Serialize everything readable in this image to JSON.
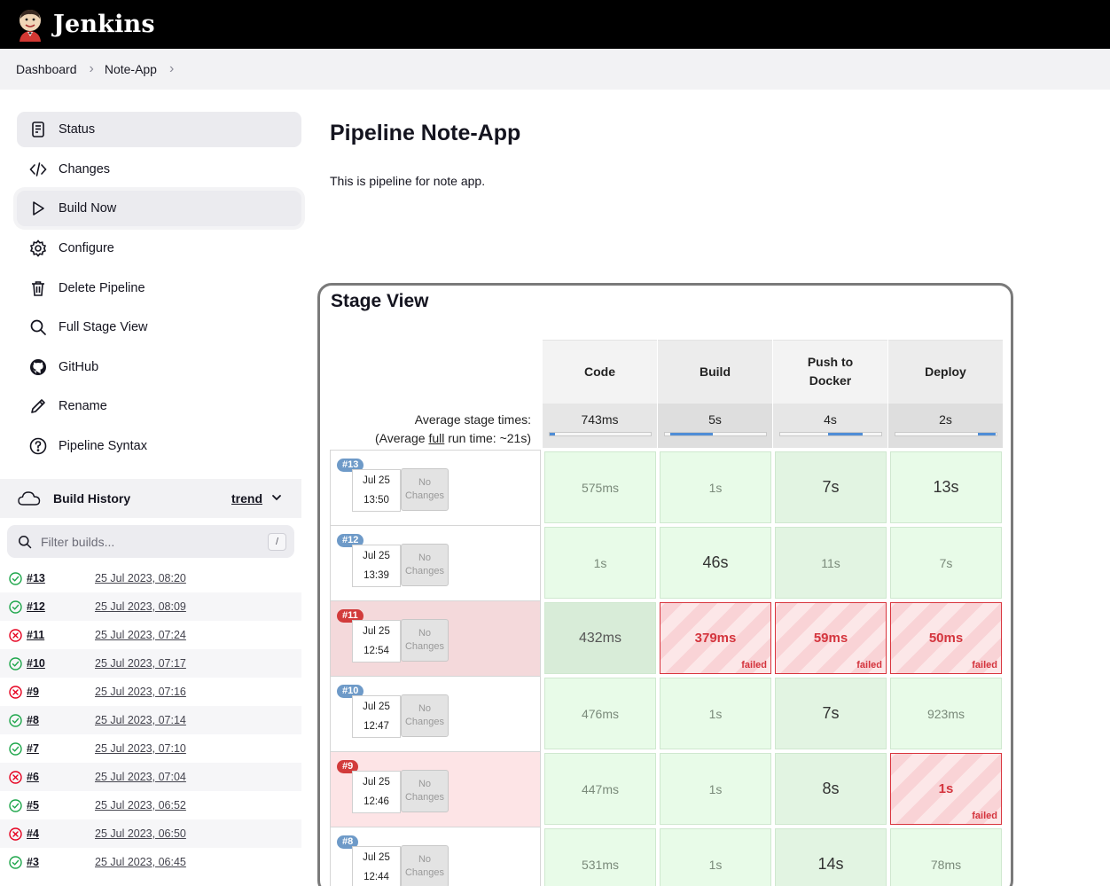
{
  "header": {
    "app_name": "Jenkins"
  },
  "breadcrumb": [
    "Dashboard",
    "Note-App"
  ],
  "sidebar": {
    "tasks": [
      {
        "label": "Status",
        "icon": "status-icon"
      },
      {
        "label": "Changes",
        "icon": "code-icon"
      },
      {
        "label": "Build Now",
        "icon": "play-icon"
      },
      {
        "label": "Configure",
        "icon": "gear-icon"
      },
      {
        "label": "Delete Pipeline",
        "icon": "trash-icon"
      },
      {
        "label": "Full Stage View",
        "icon": "search-icon"
      },
      {
        "label": "GitHub",
        "icon": "github-icon"
      },
      {
        "label": "Rename",
        "icon": "pencil-icon"
      },
      {
        "label": "Pipeline Syntax",
        "icon": "help-icon"
      }
    ]
  },
  "build_history": {
    "title": "Build History",
    "trend_label": "trend",
    "filter_placeholder": "Filter builds...",
    "filter_shortcut": "/",
    "builds": [
      {
        "number": "#13",
        "date": "25 Jul 2023, 08:20",
        "status": "success"
      },
      {
        "number": "#12",
        "date": "25 Jul 2023, 08:09",
        "status": "success"
      },
      {
        "number": "#11",
        "date": "25 Jul 2023, 07:24",
        "status": "failed"
      },
      {
        "number": "#10",
        "date": "25 Jul 2023, 07:17",
        "status": "success"
      },
      {
        "number": "#9",
        "date": "25 Jul 2023, 07:16",
        "status": "failed"
      },
      {
        "number": "#8",
        "date": "25 Jul 2023, 07:14",
        "status": "success"
      },
      {
        "number": "#7",
        "date": "25 Jul 2023, 07:10",
        "status": "success"
      },
      {
        "number": "#6",
        "date": "25 Jul 2023, 07:04",
        "status": "failed"
      },
      {
        "number": "#5",
        "date": "25 Jul 2023, 06:52",
        "status": "success"
      },
      {
        "number": "#4",
        "date": "25 Jul 2023, 06:50",
        "status": "failed"
      },
      {
        "number": "#3",
        "date": "25 Jul 2023, 06:45",
        "status": "success"
      }
    ]
  },
  "main": {
    "title": "Pipeline Note-App",
    "description": "This is pipeline for note app."
  },
  "stage_view": {
    "title": "Stage View",
    "avg_label_line1": "Average stage times:",
    "avg_label_prefix": "(Average ",
    "avg_label_link": "full",
    "avg_label_suffix": " run time: ~21s)",
    "no_changes_line1": "No",
    "no_changes_line2": "Changes",
    "failed_label": "failed",
    "stages": [
      {
        "name": "Code",
        "avg": "743ms",
        "avg_fraction": 0.05
      },
      {
        "name": "Build",
        "avg": "5s",
        "avg_fraction": 0.42
      },
      {
        "name": "Push to Docker",
        "avg": "4s",
        "avg_fraction": 0.35
      },
      {
        "name": "Deploy",
        "avg": "2s",
        "avg_fraction": 0.17
      }
    ],
    "runs": [
      {
        "badge": "#13",
        "date": "Jul 25",
        "time": "13:50",
        "status": "success",
        "cells": [
          {
            "v": "575ms",
            "s": "ok"
          },
          {
            "v": "1s",
            "s": "ok"
          },
          {
            "v": "7s",
            "s": "ok-big"
          },
          {
            "v": "13s",
            "s": "ok-big"
          }
        ]
      },
      {
        "badge": "#12",
        "date": "Jul 25",
        "time": "13:39",
        "status": "success",
        "cells": [
          {
            "v": "1s",
            "s": "ok"
          },
          {
            "v": "46s",
            "s": "ok-big"
          },
          {
            "v": "11s",
            "s": "ok"
          },
          {
            "v": "7s",
            "s": "ok"
          }
        ]
      },
      {
        "badge": "#11",
        "date": "Jul 25",
        "time": "12:54",
        "status": "failed",
        "cells": [
          {
            "v": "432ms",
            "s": "dim"
          },
          {
            "v": "379ms",
            "s": "fail"
          },
          {
            "v": "59ms",
            "s": "fail"
          },
          {
            "v": "50ms",
            "s": "fail"
          }
        ]
      },
      {
        "badge": "#10",
        "date": "Jul 25",
        "time": "12:47",
        "status": "success",
        "cells": [
          {
            "v": "476ms",
            "s": "ok"
          },
          {
            "v": "1s",
            "s": "ok"
          },
          {
            "v": "7s",
            "s": "ok-big"
          },
          {
            "v": "923ms",
            "s": "ok"
          }
        ]
      },
      {
        "badge": "#9",
        "date": "Jul 25",
        "time": "12:46",
        "status": "failed-light",
        "cells": [
          {
            "v": "447ms",
            "s": "ok"
          },
          {
            "v": "1s",
            "s": "ok"
          },
          {
            "v": "8s",
            "s": "ok-big"
          },
          {
            "v": "1s",
            "s": "fail"
          }
        ]
      },
      {
        "badge": "#8",
        "date": "Jul 25",
        "time": "12:44",
        "status": "success",
        "cells": [
          {
            "v": "531ms",
            "s": "ok"
          },
          {
            "v": "1s",
            "s": "ok"
          },
          {
            "v": "14s",
            "s": "ok-big"
          },
          {
            "v": "78ms",
            "s": "ok"
          }
        ]
      }
    ]
  }
}
